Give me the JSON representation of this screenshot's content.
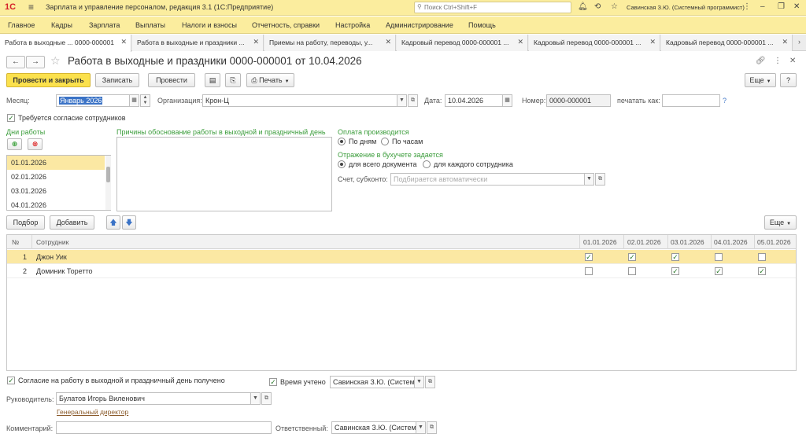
{
  "titlebar": {
    "logo": "1С",
    "app_title": "Зарплата и управление персоналом, редакция 3.1  (1С:Предприятие)",
    "search_placeholder": "Поиск Ctrl+Shift+F",
    "user": "Савинская З.Ю. (Системный программист)"
  },
  "menu": [
    "Главное",
    "Кадры",
    "Зарплата",
    "Выплаты",
    "Налоги и взносы",
    "Отчетность, справки",
    "Настройка",
    "Администрирование",
    "Помощь"
  ],
  "tabs": [
    {
      "label": "Работа в выходные ... 0000-000001"
    },
    {
      "label": "Работа в выходные и праздники ..."
    },
    {
      "label": "Приемы на работу, переводы, у..."
    },
    {
      "label": "Кадровый перевод 0000-000001 ..."
    },
    {
      "label": "Кадровый перевод 0000-000001 ..."
    },
    {
      "label": "Кадровый перевод 0000-000001 ..."
    }
  ],
  "form": {
    "title": "Работа в выходные и праздники 0000-000001 от 10.04.2026",
    "toolbar": {
      "post_close": "Провести и закрыть",
      "save": "Записать",
      "post": "Провести",
      "print": "Печать",
      "more": "Еще",
      "help": "?"
    },
    "month_label": "Месяц:",
    "month_value": "Январь 2026",
    "org_label": "Организация:",
    "org_value": "Крон-Ц",
    "date_label": "Дата:",
    "date_value": "10.04.2026",
    "number_label": "Номер:",
    "number_value": "0000-000001",
    "print_as_label": "печатать как:",
    "print_as_value": "",
    "consent_required_label": "Требуется согласие сотрудников",
    "work_days_label": "Дни работы",
    "work_days": [
      "01.01.2026",
      "02.01.2026",
      "03.01.2026",
      "04.01.2026"
    ],
    "reasons_label": "Причины обоснование работы в выходной и праздничный день",
    "payment_label": "Оплата производится",
    "pay_by_days": "По дням",
    "pay_by_hours": "По часам",
    "accounting_label": "Отражение в бухучете задается",
    "acc_whole_doc": "для всего документа",
    "acc_each_emp": "для каждого сотрудника",
    "account_label": "Счет, субконто:",
    "account_placeholder": "Подбирается автоматически",
    "select_btn": "Подбор",
    "add_btn": "Добавить",
    "table_more": "Еще"
  },
  "table": {
    "col_num": "№",
    "col_employee": "Сотрудник",
    "date_cols": [
      "01.01.2026",
      "02.01.2026",
      "03.01.2026",
      "04.01.2026",
      "05.01.2026"
    ],
    "rows": [
      {
        "num": "1",
        "employee": "Джон Уик",
        "checks": [
          true,
          true,
          true,
          false,
          false
        ]
      },
      {
        "num": "2",
        "employee": "Доминик Торетто",
        "checks": [
          false,
          false,
          true,
          true,
          true
        ]
      }
    ]
  },
  "footer": {
    "consent_received_label": "Согласие на работу в выходной и праздничный день получено",
    "time_accounted_label": "Время учтено",
    "time_accounted_value": "Савинская З.Ю. (Систем",
    "manager_label": "Руководитель:",
    "manager_value": "Булатов Игорь Виленович",
    "manager_position": "Генеральный директор",
    "comment_label": "Комментарий:",
    "comment_value": "",
    "responsible_label": "Ответственный:",
    "responsible_value": "Савинская З.Ю. (Систем"
  }
}
